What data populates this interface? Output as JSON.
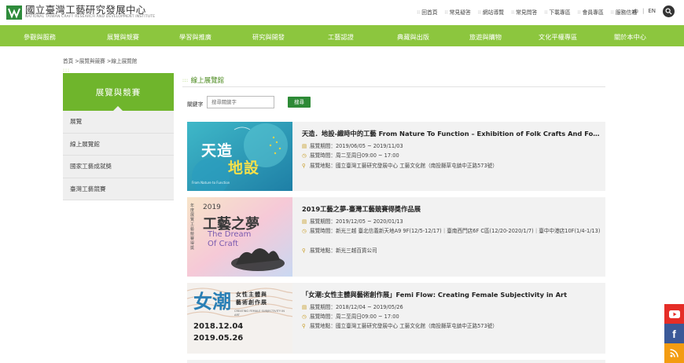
{
  "header": {
    "logo_zh": "國立臺灣工藝研究發展中心",
    "logo_en": "NATIONAL TAIWAN CRAFT RESEARCH AND DEVELOPMENT INSTITUTE",
    "top_links": [
      "回首頁",
      "常見疑答",
      "網站導覽",
      "常見問答",
      "下載專區",
      "會員專區",
      "服務信箱"
    ],
    "lang_zh": "中",
    "lang_en": "EN"
  },
  "nav": {
    "items": [
      "參觀與服務",
      "展覽與競賽",
      "學習與推廣",
      "研究與開發",
      "工藝認證",
      "典藏與出版",
      "旅遊與購物",
      "文化平權專區",
      "關於本中心"
    ]
  },
  "breadcrumb": "首頁 >展覽與競賽 >線上展覽館",
  "sidebar": {
    "title": "展覽與競賽",
    "items": [
      "展覽",
      "線上展覽館",
      "國家工藝成就獎",
      "臺灣工藝競賽"
    ]
  },
  "main": {
    "title": "線上展覽館",
    "keyword_label": "關鍵字",
    "keyword_placeholder": "搜尋關鍵字",
    "search_button": "搜尋",
    "cards": [
      {
        "title": "天造．地設-織時中的工藝 From Nature To Function – Exhibition of Folk Crafts And Fou...",
        "period_label": "展覽期間：2019/06/05 ~ 2019/11/03",
        "hours_label": "展覽時間：周二至周日09:00 ~ 17:00",
        "venue_label": "展覽地點：國立臺灣工藝研究發展中心 工藝文化館（南投縣草屯鎮中正路573號）",
        "thumb_text_big": "天造地設",
        "thumb_text_small": "From Nature to Function"
      },
      {
        "title": "2019工藝之夢-臺灣工藝競賽得獎作品展",
        "period_label": "展覽期間：2019/12/05 ~ 2020/01/13",
        "hours_label": "展覽時間：新光三越 臺北信義新天地A9 9F(12/5-12/17)｜臺南西門店6F C區(12/20-2020/1/7)｜臺中中港店10F(1/4-1/13)",
        "venue_label": "展覽地點：新光三越百貨公司",
        "thumb_year": "2019",
        "thumb_text_big": "工藝之夢",
        "thumb_en_1": "The Dream",
        "thumb_en_2": "Of Craft",
        "thumb_side": "年度展覽 工藝競賽得獎"
      },
      {
        "title": "「女潮:女性主體與藝術創作展」Femi Flow: Creating Female Subjectivity in Art",
        "period_label": "展覽期間：2018/12/04 ~ 2019/05/26",
        "hours_label": "展覽時間：周二至周日09:00 ~ 17:00",
        "venue_label": "展覽地點：國立臺灣工藝研究發展中心 工藝文化館（南投縣草屯鎮中正路573號）",
        "thumb_big": "女潮",
        "thumb_sub_1": "女性主體與",
        "thumb_sub_2": "藝術創作展",
        "thumb_en": "CREATING FEMALE SUBJECTIVITY IN ART",
        "thumb_date_1": "2018.12.04",
        "thumb_date_2": "2019.05.26"
      }
    ]
  },
  "social": {
    "youtube": "youtube-icon",
    "facebook": "f",
    "rss": "rss-icon"
  },
  "colors": {
    "nav_green": "#8cc63e",
    "side_green": "#6fb52c",
    "button_green": "#2d8a36",
    "youtube_red": "#e52d27",
    "facebook_blue": "#3b5998",
    "rss_orange": "#f39c12"
  }
}
